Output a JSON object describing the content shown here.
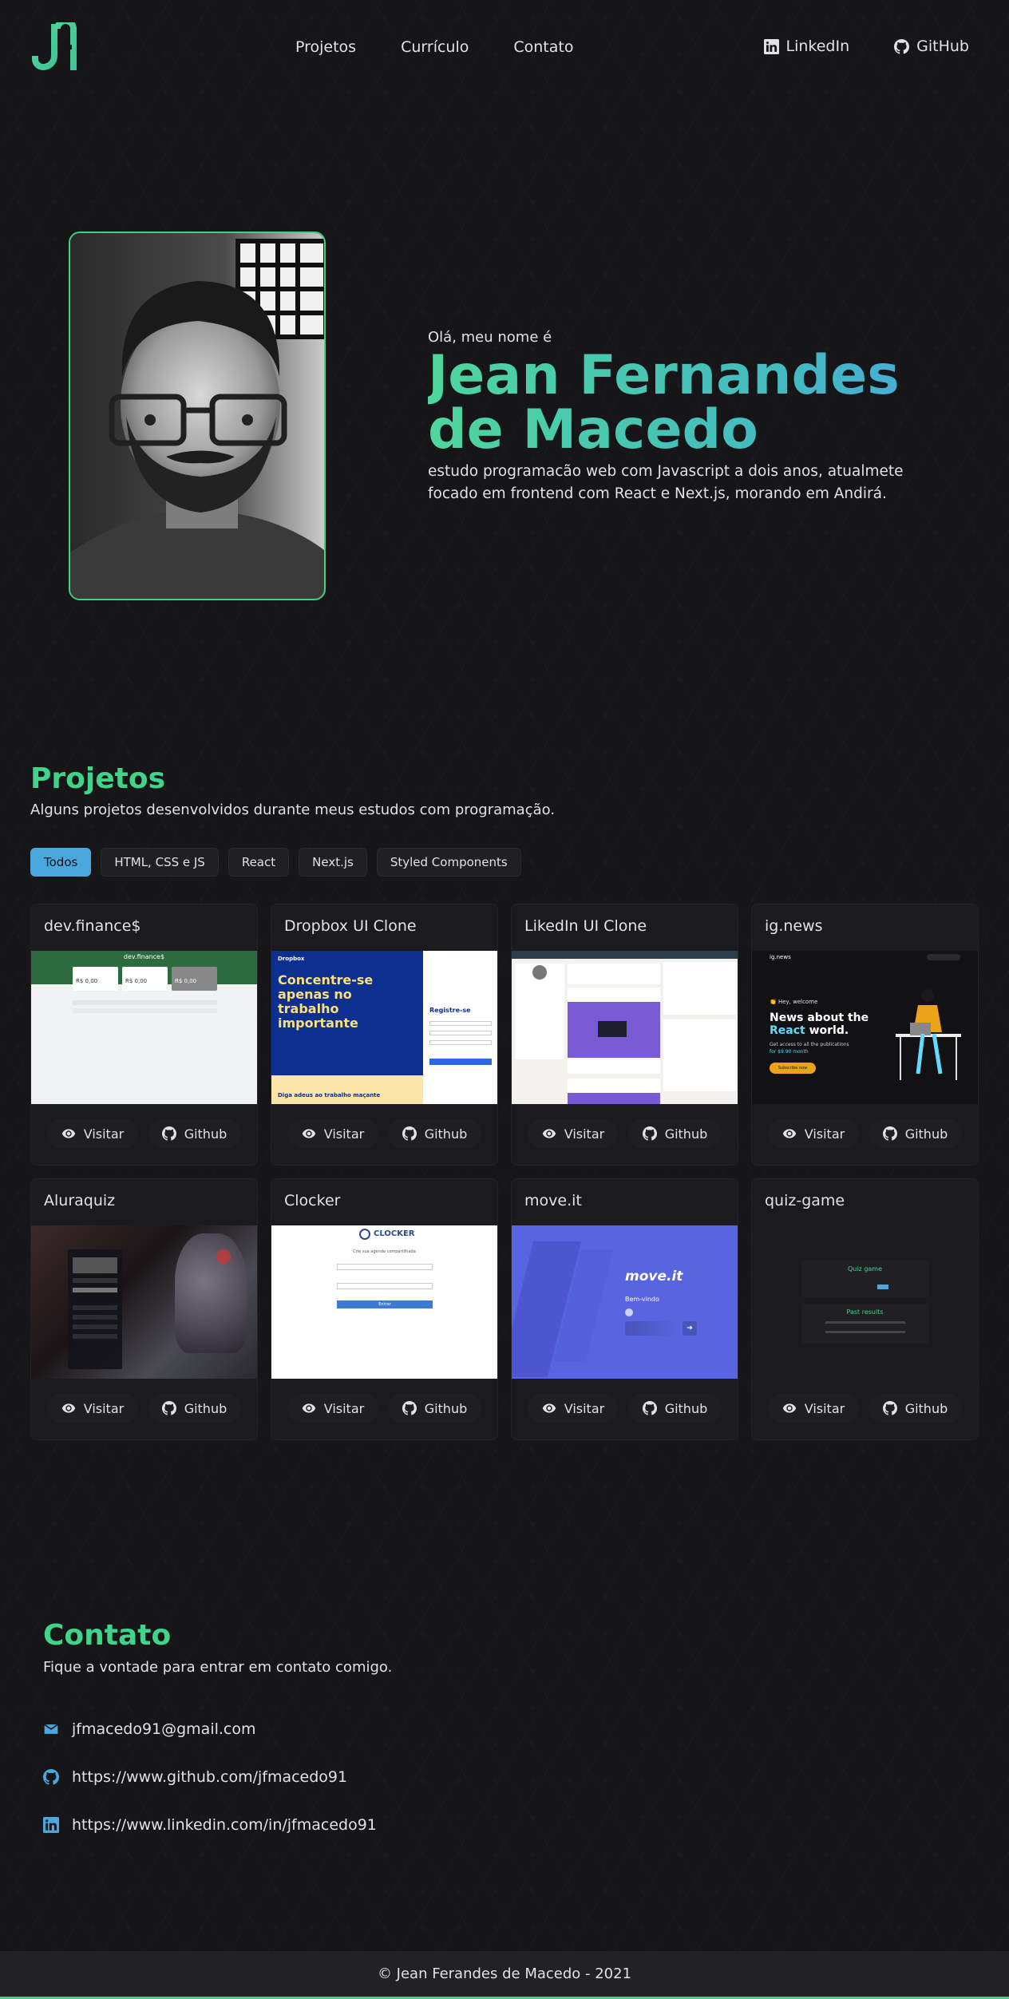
{
  "header": {
    "logo_alt": "JM",
    "nav": [
      {
        "label": "Projetos"
      },
      {
        "label": "Currículo"
      },
      {
        "label": "Contato"
      }
    ],
    "social": [
      {
        "label": "LinkedIn",
        "icon": "linkedin-icon"
      },
      {
        "label": "GitHub",
        "icon": "github-icon"
      }
    ]
  },
  "hero": {
    "greeting": "Olá, meu nome é",
    "name_line1": "Jean Fernandes",
    "name_line2": "de Macedo",
    "bio": "estudo programacão web com Javascript a dois anos, atualmete focado em frontend com React e Next.js, morando em Andirá.",
    "photo_border_color": "#3ed47e"
  },
  "projects": {
    "title": "Projetos",
    "subtitle": "Alguns projetos desenvolvidos durante meus estudos com programação.",
    "filters": [
      {
        "label": "Todos",
        "active": true
      },
      {
        "label": "HTML, CSS e JS",
        "active": false
      },
      {
        "label": "React",
        "active": false
      },
      {
        "label": "Next.js",
        "active": false
      },
      {
        "label": "Styled Components",
        "active": false
      }
    ],
    "visit_label": "Visitar",
    "github_label": "Github",
    "cards": [
      {
        "title": "dev.finance$",
        "thumb": "devfinance"
      },
      {
        "title": "Dropbox UI Clone",
        "thumb": "dropbox"
      },
      {
        "title": "LikedIn UI Clone",
        "thumb": "linkedin"
      },
      {
        "title": "ig.news",
        "thumb": "ignews"
      },
      {
        "title": "Aluraquiz",
        "thumb": "aluraquiz"
      },
      {
        "title": "Clocker",
        "thumb": "clocker"
      },
      {
        "title": "move.it",
        "thumb": "moveit"
      },
      {
        "title": "quiz-game",
        "thumb": "quizgame"
      }
    ],
    "thumb_text": {
      "devfinance_brand": "dev.finance$",
      "devfinance_value1": "R$ 0,00",
      "devfinance_value2": "R$ 0,00",
      "devfinance_value3": "R$ 0,00",
      "dropbox_brand": "Dropbox",
      "dropbox_headline": "Concentre-se apenas no trabalho importante",
      "dropbox_footer": "Diga adeus ao trabalho maçante",
      "dropbox_form_title": "Registre-se",
      "ignews_brand": "ig.news",
      "ignews_hey": "👏 Hey, welcome",
      "ignews_headline1": "News about the",
      "ignews_headline2": "React",
      "ignews_headline3": " world.",
      "ignews_sub1": "Get access to all the publications",
      "ignews_sub2": "for $9.90 month",
      "ignews_btn": "Subscribe now",
      "clocker_brand": "CLOCKER",
      "clocker_sub": "Crie sua agenda compartilhada",
      "clocker_btn": "Entrar",
      "moveit_brand": "move.it",
      "moveit_welcome": "Bem-vindo",
      "quiz_title": "Quiz game",
      "quiz_past": "Past results"
    }
  },
  "contact": {
    "title": "Contato",
    "subtitle": "Fique a vontade para entrar em contato comigo.",
    "items": [
      {
        "label": "jfmacedo91@gmail.com",
        "icon": "mail-icon"
      },
      {
        "label": "https://www.github.com/jfmacedo91",
        "icon": "github-icon"
      },
      {
        "label": "https://www.linkedin.com/in/jfmacedo91",
        "icon": "linkedin-icon"
      }
    ]
  },
  "footer": {
    "text": "© Jean Ferandes de Macedo - 2021"
  },
  "colors": {
    "accent_green": "#3fd48a",
    "accent_blue": "#4aa8de",
    "background": "#161618"
  }
}
